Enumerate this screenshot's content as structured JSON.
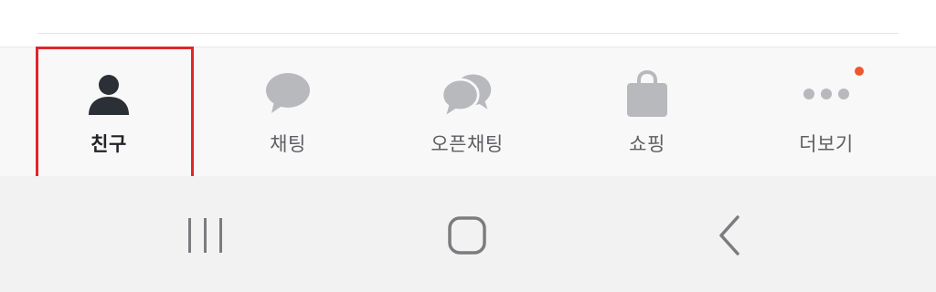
{
  "colors": {
    "active_icon": "#2b2f36",
    "inactive_icon": "#b8b9bd",
    "highlight": "#e0262c",
    "notification": "#f1572e",
    "nav_icon": "#7c7c80"
  },
  "tabbar": {
    "tabs": [
      {
        "label": "친구",
        "icon": "person-icon",
        "active": true
      },
      {
        "label": "채팅",
        "icon": "chat-bubble-icon",
        "active": false
      },
      {
        "label": "오픈채팅",
        "icon": "open-chat-icon",
        "active": false
      },
      {
        "label": "쇼핑",
        "icon": "shopping-bag-icon",
        "active": false
      },
      {
        "label": "더보기",
        "icon": "more-dots-icon",
        "active": false,
        "notification": true
      }
    ]
  },
  "system_nav": {
    "buttons": [
      {
        "icon": "recent-apps-icon"
      },
      {
        "icon": "home-icon"
      },
      {
        "icon": "back-icon"
      }
    ]
  }
}
